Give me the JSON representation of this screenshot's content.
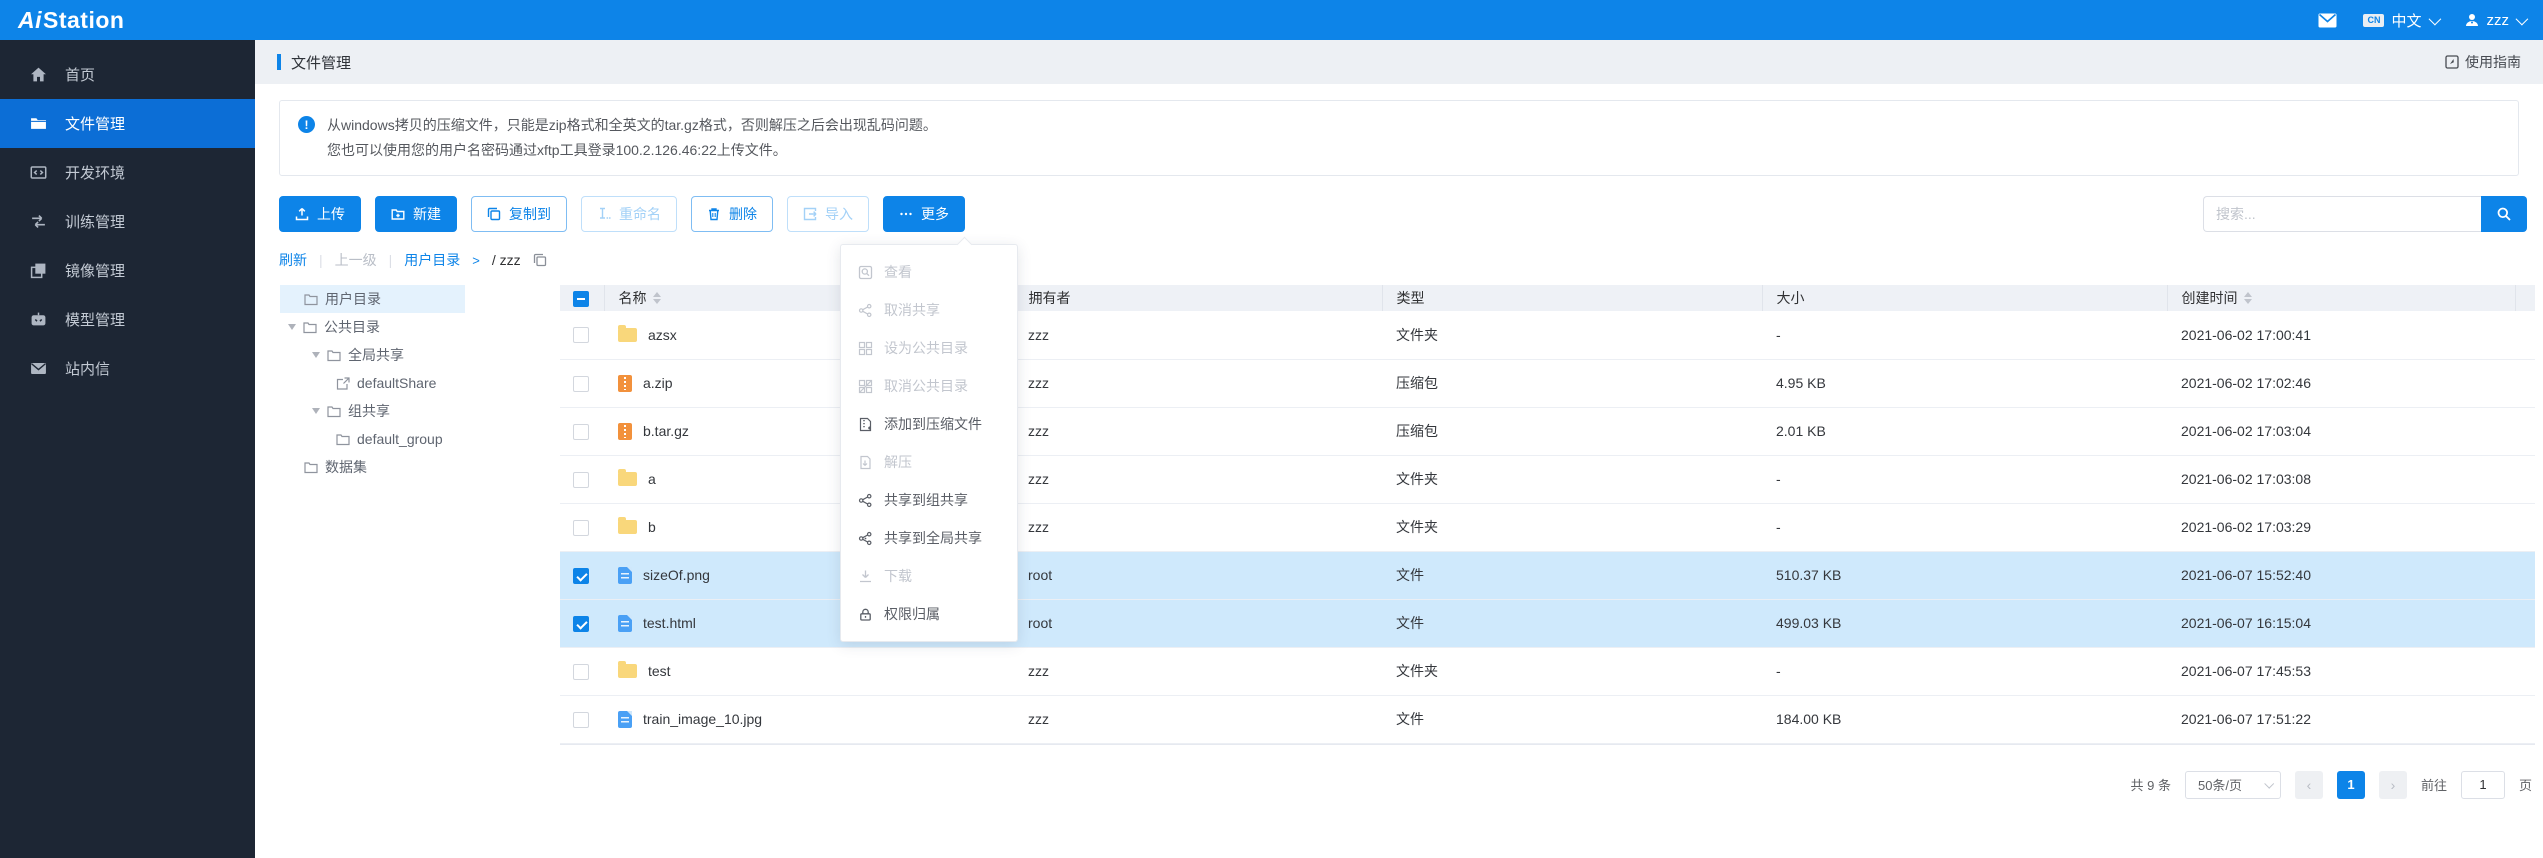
{
  "topbar": {
    "logo_text": "AiStation",
    "lang_badge": "CN",
    "language": "中文",
    "username": "zzz"
  },
  "sidebar": {
    "items": [
      {
        "label": "首页"
      },
      {
        "label": "文件管理"
      },
      {
        "label": "开发环境"
      },
      {
        "label": "训练管理"
      },
      {
        "label": "镜像管理"
      },
      {
        "label": "模型管理"
      },
      {
        "label": "站内信"
      }
    ]
  },
  "page": {
    "title": "文件管理",
    "guide_link": "使用指南"
  },
  "notice": {
    "line1": "从windows拷贝的压缩文件，只能是zip格式和全英文的tar.gz格式，否则解压之后会出现乱码问题。",
    "line2": "您也可以使用您的用户名密码通过xftp工具登录100.2.126.46:22上传文件。"
  },
  "toolbar": {
    "upload": "上传",
    "new": "新建",
    "copy_to": "复制到",
    "rename": "重命名",
    "delete": "删除",
    "import": "导入",
    "more": "更多"
  },
  "search": {
    "placeholder": "搜索..."
  },
  "breadcrumb": {
    "refresh": "刷新",
    "up": "上一级",
    "root": "用户目录",
    "current": "/ zzz"
  },
  "tree": {
    "user_dir": "用户目录",
    "public_dir": "公共目录",
    "global_share": "全局共享",
    "default_share": "defaultShare",
    "group_share": "组共享",
    "default_group": "default_group",
    "dataset": "数据集"
  },
  "table": {
    "headers": {
      "name": "名称",
      "owner": "拥有者",
      "type": "类型",
      "size": "大小",
      "created": "创建时间"
    },
    "rows": [
      {
        "name": "azsx",
        "owner": "zzz",
        "type": "文件夹",
        "size": "-",
        "created": "2021-06-02 17:00:41",
        "icon": "folder",
        "checked": "false"
      },
      {
        "name": "a.zip",
        "owner": "zzz",
        "type": "压缩包",
        "size": "4.95 KB",
        "created": "2021-06-02 17:02:46",
        "icon": "zip",
        "checked": "false"
      },
      {
        "name": "b.tar.gz",
        "owner": "zzz",
        "type": "压缩包",
        "size": "2.01 KB",
        "created": "2021-06-02 17:03:04",
        "icon": "zip",
        "checked": "false"
      },
      {
        "name": "a",
        "owner": "zzz",
        "type": "文件夹",
        "size": "-",
        "created": "2021-06-02 17:03:08",
        "icon": "folder",
        "checked": "false"
      },
      {
        "name": "b",
        "owner": "zzz",
        "type": "文件夹",
        "size": "-",
        "created": "2021-06-02 17:03:29",
        "icon": "folder",
        "checked": "false"
      },
      {
        "name": "sizeOf.png",
        "owner": "root",
        "type": "文件",
        "size": "510.37 KB",
        "created": "2021-06-07 15:52:40",
        "icon": "file",
        "checked": "true"
      },
      {
        "name": "test.html",
        "owner": "root",
        "type": "文件",
        "size": "499.03 KB",
        "created": "2021-06-07 16:15:04",
        "icon": "file",
        "checked": "true"
      },
      {
        "name": "test",
        "owner": "zzz",
        "type": "文件夹",
        "size": "-",
        "created": "2021-06-07 17:45:53",
        "icon": "folder",
        "checked": "false"
      },
      {
        "name": "train_image_10.jpg",
        "owner": "zzz",
        "type": "文件",
        "size": "184.00 KB",
        "created": "2021-06-07 17:51:22",
        "icon": "file",
        "checked": "false"
      }
    ]
  },
  "menu": {
    "items": [
      {
        "label": "查看",
        "disabled": "true",
        "annotated": "false"
      },
      {
        "label": "取消共享",
        "disabled": "true",
        "annotated": "false"
      },
      {
        "label": "设为公共目录",
        "disabled": "true",
        "annotated": "false"
      },
      {
        "label": "取消公共目录",
        "disabled": "true",
        "annotated": "false"
      },
      {
        "label": "添加到压缩文件",
        "disabled": "false",
        "annotated": "true"
      },
      {
        "label": "解压",
        "disabled": "true",
        "annotated": "false"
      },
      {
        "label": "共享到组共享",
        "disabled": "false",
        "annotated": "false"
      },
      {
        "label": "共享到全局共享",
        "disabled": "false",
        "annotated": "false"
      },
      {
        "label": "下载",
        "disabled": "true",
        "annotated": "false"
      },
      {
        "label": "权限归属",
        "disabled": "false",
        "annotated": "false"
      }
    ]
  },
  "pagination": {
    "total": "共 9 条",
    "page_size": "50条/页",
    "current_page": "1",
    "goto_label": "前往",
    "goto_value": "1",
    "page_unit": "页"
  },
  "colors": {
    "accent": "#0d84e8",
    "sidebar": "#1d2634",
    "selected_row": "#cfe9fc",
    "annotation": "#ed2d2d"
  }
}
